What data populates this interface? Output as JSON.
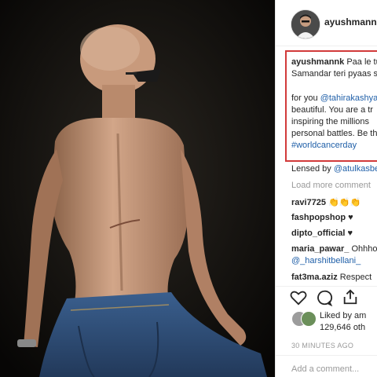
{
  "post": {
    "username": "ayushmannk",
    "caption_line1": "Paa le tu",
    "caption_line2": "Samandar teri pyaas s",
    "caption_for": "for you",
    "caption_mention": "@tahirakashya",
    "caption_line4": "beautiful. You are a tr",
    "caption_line5": "inspiring the millions",
    "caption_line6": "personal battles. Be th",
    "caption_hashtag": "#worldcancerday",
    "lensed_by": "Lensed by",
    "lensed_mention": "@atulkasbe",
    "load_more": "Load more comment",
    "comments": [
      {
        "user": "ravi7725",
        "text": "👏👏👏"
      },
      {
        "user": "fashpopshop",
        "text": "♥"
      },
      {
        "user": "dipto_official",
        "text": "♥"
      },
      {
        "user": "maria_pawar_",
        "text": "Ohhho"
      },
      {
        "user": "",
        "text": "@_harshitbellani_"
      },
      {
        "user": "fat3ma.aziz",
        "text": "Respect"
      }
    ],
    "liked_by": "Liked by am",
    "likes_count": "129,646 oth",
    "timestamp": "30 MINUTES AGO",
    "add_comment_placeholder": "Add a comment..."
  },
  "icons": {
    "like": "heart-icon",
    "comment": "comment-icon",
    "share": "share-icon"
  }
}
